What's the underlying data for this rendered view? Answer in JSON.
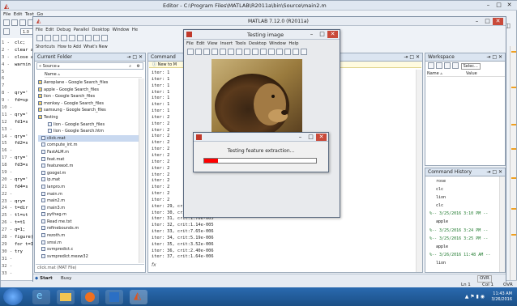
{
  "editor": {
    "title": "Editor - C:\\Program Files\\MATLAB\\R2011a\\bin\\Source\\main2.m",
    "menu": [
      "File",
      "Edit",
      "Text",
      "Go"
    ],
    "font_size": "1.0",
    "line_numbers": [
      "1 -",
      "2 -",
      "3 -",
      "4 -",
      "5",
      "6",
      "7",
      "8 -",
      "9 -",
      "10 -",
      "11 -",
      "12",
      "13 -",
      "14 -",
      "15",
      "16 -",
      "17 -",
      "18",
      "19 -",
      "20 -",
      "21",
      "22 -",
      "23 -",
      "24 -",
      "25 -",
      "26 -",
      "27 -",
      "28 -",
      "29",
      "30 -",
      "31 -",
      "32 -",
      "33 -"
    ],
    "code_lines": [
      "clc;",
      "clear al",
      "close al",
      "warnin",
      "",
      "",
      "",
      "qry='",
      "fd=sp",
      "",
      "qry='",
      "fd1=s",
      "",
      "qry='",
      "fd2=s",
      "",
      "qry='",
      "fd3=s",
      "",
      "qry='",
      "fd4=s",
      "",
      "qry=",
      "t=dir",
      "tl=st",
      "t=t1",
      "q=1;",
      "figure('",
      "for t=1:",
      "try",
      "",
      "",
      ""
    ]
  },
  "matlab": {
    "title": "MATLAB 7.12.0 (R2011a)",
    "menu": [
      "File",
      "Edit",
      "Debug",
      "Parallel",
      "Desktop",
      "Window",
      "He"
    ],
    "shortcuts_label": "Shortcuts",
    "shortcut_items": [
      "How to Add",
      "What's New"
    ],
    "current_folder": {
      "title": "Current Folder",
      "path": "« Source ▸",
      "header": "Name ▵",
      "items": [
        "Aeroplane - Google Search_files",
        "apple - Google Search_files",
        "lion - Google Search_files",
        "monkey - Google Search_files",
        "samsung - Google Search_files",
        "Testing",
        "lion - Google Search_files",
        "lion - Google Search.htm",
        "click.mat",
        "compute_int.m",
        "FastALM.m",
        "feat.mat",
        "featureext.m",
        "googel.m",
        "ip.mat",
        "lanpro.m",
        "main.m",
        "main2.m",
        "main3.m",
        "pythag.m",
        "Read me.txt",
        "refinebounds.m",
        "rezoth.m",
        "smsi.m",
        "svmpredict.c",
        "svmpredict.mexw32"
      ],
      "status": "click.mat (MAT File)"
    },
    "command_window": {
      "title": "Command",
      "banner": "New to M",
      "lines": [
        "iter: 1",
        "iter: 1",
        "iter: 1",
        "iter: 1",
        "iter: 1",
        "iter: 1",
        "iter: 1",
        "iter: 2",
        "iter: 2",
        "iter: 2",
        "iter: 2",
        "iter: 2",
        "iter: 2",
        "iter: 2",
        "iter: 2",
        "iter: 2",
        "iter: 2",
        "iter: 2",
        "iter: 2",
        "iter: 2",
        "iter: 2",
        "iter: 29, crit:3.83e-005",
        "iter: 30, crit:2.56e-005",
        "iter: 31, crit:1.70e-005",
        "iter: 32, crit:1.14e-005",
        "iter: 33, crit:7.65e-006",
        "iter: 34, crit:5.19e-006",
        "iter: 35, crit:3.52e-006",
        "iter: 36, crit:2.40e-006",
        "iter: 37, crit:1.64e-006"
      ],
      "prompt": "fx"
    },
    "workspace": {
      "title": "Workspace",
      "select": "Selec...",
      "col_name": "Name ▵",
      "col_value": "Value"
    },
    "command_history": {
      "title": "Command History",
      "items": [
        "rose",
        "clc",
        "lion",
        "clc",
        "%-- 3/25/2016 3:10 PM --",
        "apple",
        "%-- 3/25/2016 3:24 PM --",
        "%-- 3/25/2016 3:25 PM --",
        "apple",
        "%-- 3/26/2016 11:48 AM --",
        "lion"
      ]
    },
    "start_label": "Start",
    "busy_label": "Busy",
    "ovr_label": "OVR"
  },
  "testing_image": {
    "title": "Testing image",
    "menu": [
      "File",
      "Edit",
      "View",
      "Insert",
      "Tools",
      "Desktop",
      "Window",
      "Help"
    ]
  },
  "progress": {
    "message": "Testing feature extraction...",
    "fraction": 0.12
  },
  "status_bar": {
    "ln": "Ln 1",
    "col": "Col 1",
    "ovr": "OVR"
  },
  "tray": {
    "time": "11:43 AM",
    "date": "3/26/2016"
  },
  "colors": {
    "accent": "#1e5aa8",
    "progress_fill": "#ff0000",
    "taskbar": "#1f5c97"
  }
}
